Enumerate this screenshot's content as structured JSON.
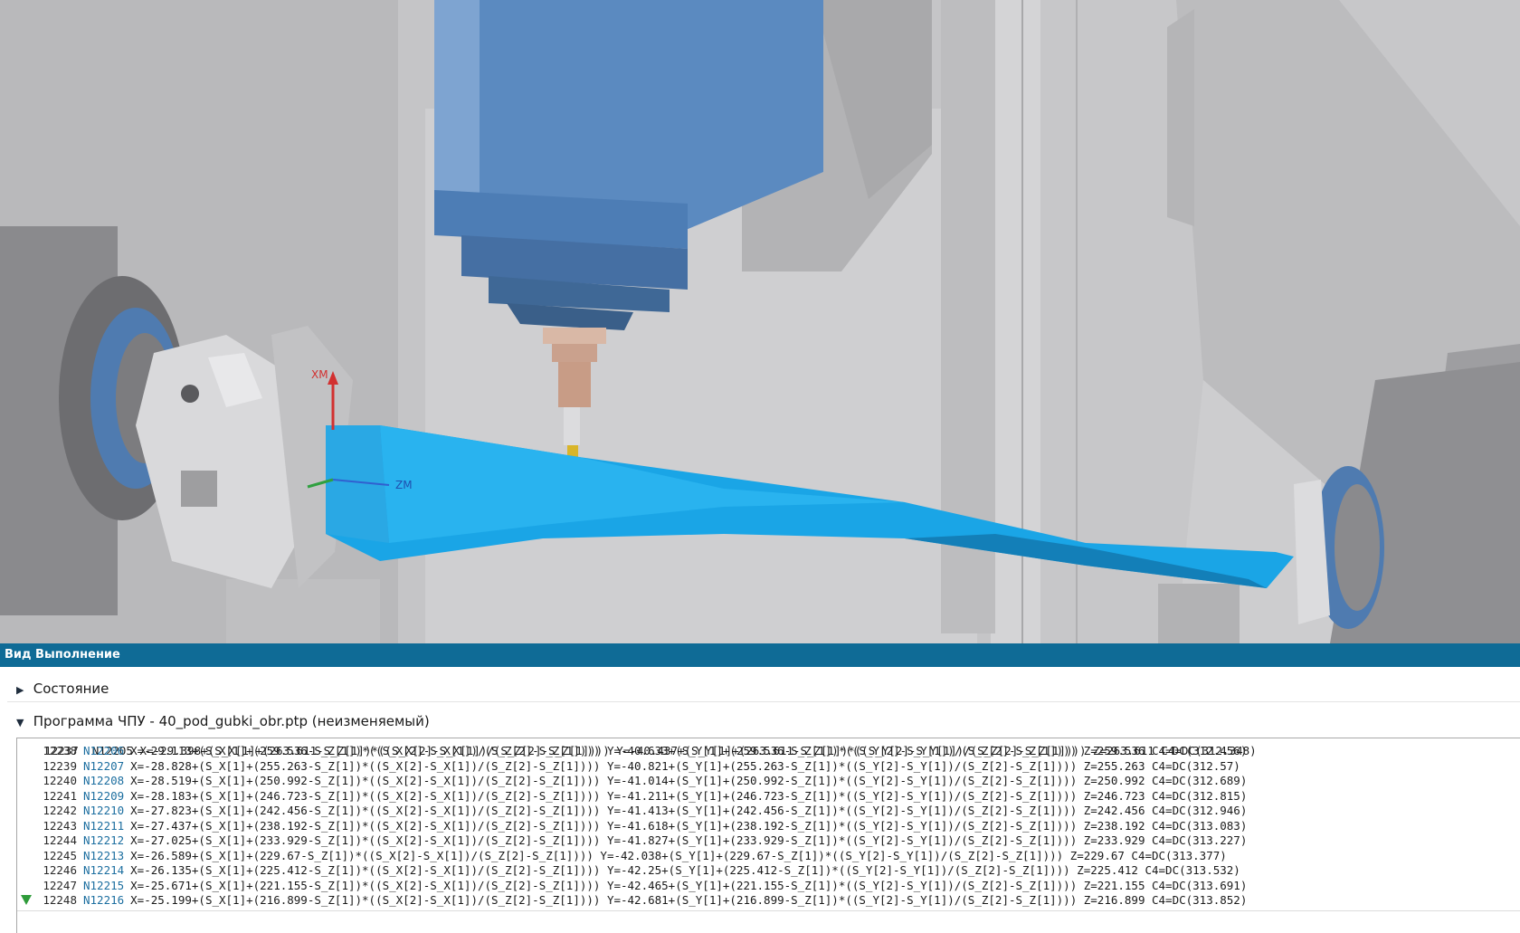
{
  "panel": {
    "title": "Вид Выполнение",
    "section_state": "Состояние",
    "section_program": "Программа ЧПУ - 40_pod_gubki_obr.ptp (неизменяемый)"
  },
  "viewport": {
    "axis_labels": {
      "xm": "XM",
      "zm": "ZM"
    },
    "colors": {
      "spindle": "#5f8ec2",
      "blade": "#1aa5e6",
      "background": "#c9c9cb"
    }
  },
  "code": {
    "partial_top_line": "12237  N12205 X=-29.398+(S_X[1]+(263.611-S_Z[1])*((S_X[2]-S_X[1])/(S_Z[2]-S_Z[1]))) Y=-40.437+(S_Y[1]+(263.611-S_Z[1])*((S_Y[2]-S_Y[1])/(S_Z[2]-S_Z[1]))) Z=263.611 C4=DC(312.348)",
    "lines": [
      {
        "num": "12238",
        "n": "N12206",
        "text": "X=-29.113+(S_X[1]+(259.536-S_Z[1])*((S_X[2]-S_X[1])/(S_Z[2]-S_Z[1]))) Y=-40.633+(S_Y[1]+(259.536-S_Z[1])*((S_Y[2]-S_Y[1])/(S_Z[2]-S_Z[1]))) Z=259.536 C4=DC(312.456)"
      },
      {
        "num": "12239",
        "n": "N12207",
        "text": "X=-28.828+(S_X[1]+(255.263-S_Z[1])*((S_X[2]-S_X[1])/(S_Z[2]-S_Z[1]))) Y=-40.821+(S_Y[1]+(255.263-S_Z[1])*((S_Y[2]-S_Y[1])/(S_Z[2]-S_Z[1]))) Z=255.263 C4=DC(312.57)"
      },
      {
        "num": "12240",
        "n": "N12208",
        "text": "X=-28.519+(S_X[1]+(250.992-S_Z[1])*((S_X[2]-S_X[1])/(S_Z[2]-S_Z[1]))) Y=-41.014+(S_Y[1]+(250.992-S_Z[1])*((S_Y[2]-S_Y[1])/(S_Z[2]-S_Z[1]))) Z=250.992 C4=DC(312.689)"
      },
      {
        "num": "12241",
        "n": "N12209",
        "text": "X=-28.183+(S_X[1]+(246.723-S_Z[1])*((S_X[2]-S_X[1])/(S_Z[2]-S_Z[1]))) Y=-41.211+(S_Y[1]+(246.723-S_Z[1])*((S_Y[2]-S_Y[1])/(S_Z[2]-S_Z[1]))) Z=246.723 C4=DC(312.815)"
      },
      {
        "num": "12242",
        "n": "N12210",
        "text": "X=-27.823+(S_X[1]+(242.456-S_Z[1])*((S_X[2]-S_X[1])/(S_Z[2]-S_Z[1]))) Y=-41.413+(S_Y[1]+(242.456-S_Z[1])*((S_Y[2]-S_Y[1])/(S_Z[2]-S_Z[1]))) Z=242.456 C4=DC(312.946)"
      },
      {
        "num": "12243",
        "n": "N12211",
        "text": "X=-27.437+(S_X[1]+(238.192-S_Z[1])*((S_X[2]-S_X[1])/(S_Z[2]-S_Z[1]))) Y=-41.618+(S_Y[1]+(238.192-S_Z[1])*((S_Y[2]-S_Y[1])/(S_Z[2]-S_Z[1]))) Z=238.192 C4=DC(313.083)"
      },
      {
        "num": "12244",
        "n": "N12212",
        "text": "X=-27.025+(S_X[1]+(233.929-S_Z[1])*((S_X[2]-S_X[1])/(S_Z[2]-S_Z[1]))) Y=-41.827+(S_Y[1]+(233.929-S_Z[1])*((S_Y[2]-S_Y[1])/(S_Z[2]-S_Z[1]))) Z=233.929 C4=DC(313.227)"
      },
      {
        "num": "12245",
        "n": "N12213",
        "text": "X=-26.589+(S_X[1]+(229.67-S_Z[1])*((S_X[2]-S_X[1])/(S_Z[2]-S_Z[1]))) Y=-42.038+(S_Y[1]+(229.67-S_Z[1])*((S_Y[2]-S_Y[1])/(S_Z[2]-S_Z[1]))) Z=229.67 C4=DC(313.377)"
      },
      {
        "num": "12246",
        "n": "N12214",
        "text": "X=-26.135+(S_X[1]+(225.412-S_Z[1])*((S_X[2]-S_X[1])/(S_Z[2]-S_Z[1]))) Y=-42.25+(S_Y[1]+(225.412-S_Z[1])*((S_Y[2]-S_Y[1])/(S_Z[2]-S_Z[1]))) Z=225.412 C4=DC(313.532)"
      },
      {
        "num": "12247",
        "n": "N12215",
        "text": "X=-25.671+(S_X[1]+(221.155-S_Z[1])*((S_X[2]-S_X[1])/(S_Z[2]-S_Z[1]))) Y=-42.465+(S_Y[1]+(221.155-S_Z[1])*((S_Y[2]-S_Y[1])/(S_Z[2]-S_Z[1]))) Z=221.155 C4=DC(313.691)"
      },
      {
        "num": "12248",
        "n": "N12216",
        "text": "X=-25.199+(S_X[1]+(216.899-S_Z[1])*((S_X[2]-S_X[1])/(S_Z[2]-S_Z[1]))) Y=-42.681+(S_Y[1]+(216.899-S_Z[1])*((S_Y[2]-S_Y[1])/(S_Z[2]-S_Z[1]))) Z=216.899 C4=DC(313.852)"
      }
    ]
  }
}
